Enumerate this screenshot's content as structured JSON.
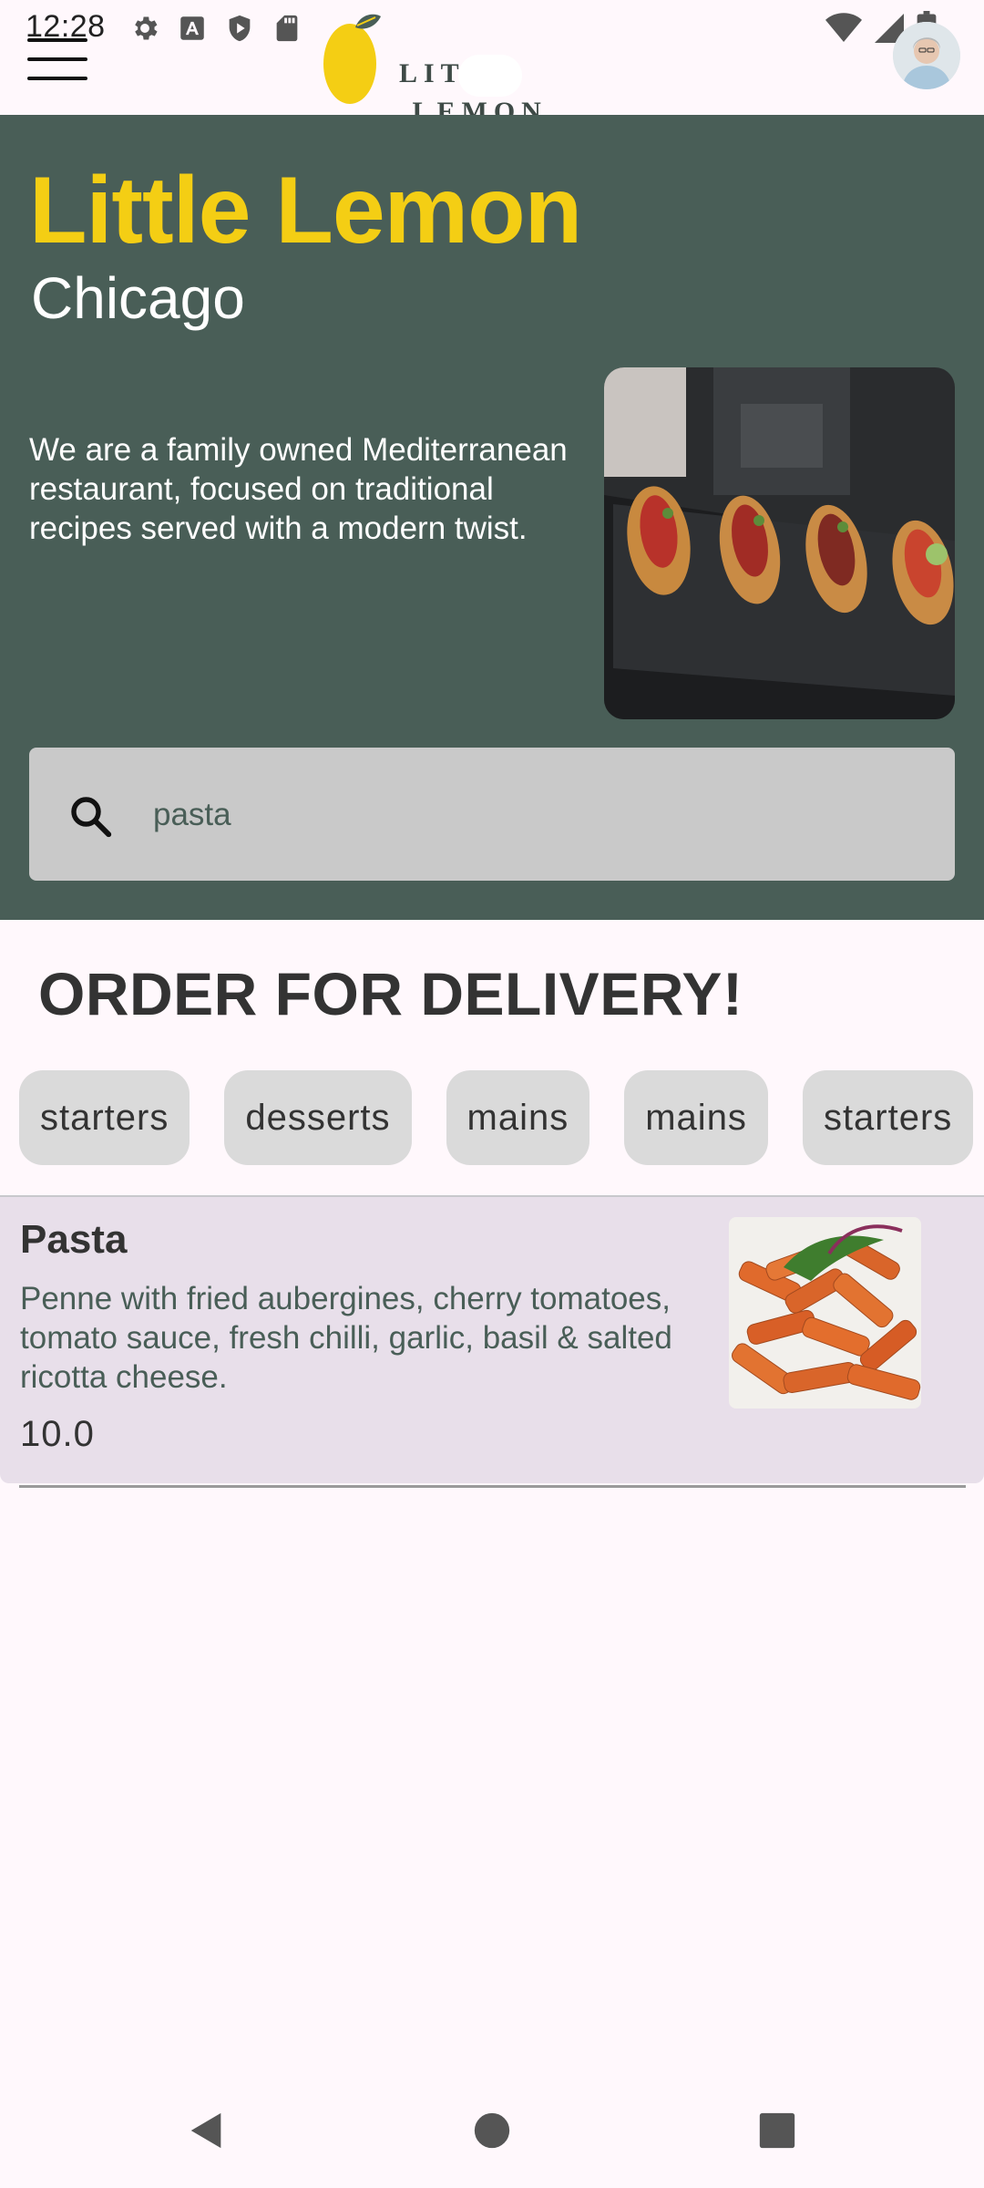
{
  "status_bar": {
    "time": "12:28",
    "left_icons": [
      "settings-icon",
      "keyboard-a-icon",
      "shield-play-icon",
      "sd-card-icon"
    ],
    "right_icons": [
      "wifi-icon",
      "cell-signal-icon",
      "battery-icon"
    ]
  },
  "header": {
    "logo_text_left": "LIT",
    "logo_text_right": "LEMON",
    "menu_icon": "hamburger-menu-icon",
    "avatar": "profile-avatar"
  },
  "hero": {
    "title": "Little Lemon",
    "city": "Chicago",
    "description": "We are a family owned Mediterranean restaurant, focused on traditional recipes served with a modern twist.",
    "search": {
      "value": "pasta",
      "icon": "search-icon"
    }
  },
  "delivery": {
    "title": "ORDER FOR DELIVERY!",
    "categories": [
      "starters",
      "desserts",
      "mains",
      "mains",
      "starters"
    ]
  },
  "menu_items": [
    {
      "name": "Pasta",
      "description": "Penne with fried aubergines, cherry tomatoes, tomato sauce, fresh chilli, garlic, basil & salted ricotta cheese.",
      "price": "10.0"
    }
  ],
  "nav_bar": {
    "buttons": [
      "back-icon",
      "home-icon",
      "recents-icon"
    ]
  },
  "colors": {
    "primary_green": "#495E57",
    "primary_yellow": "#F4CE14",
    "card_background": "#E8DFEA",
    "search_background": "#C9C9C9"
  }
}
